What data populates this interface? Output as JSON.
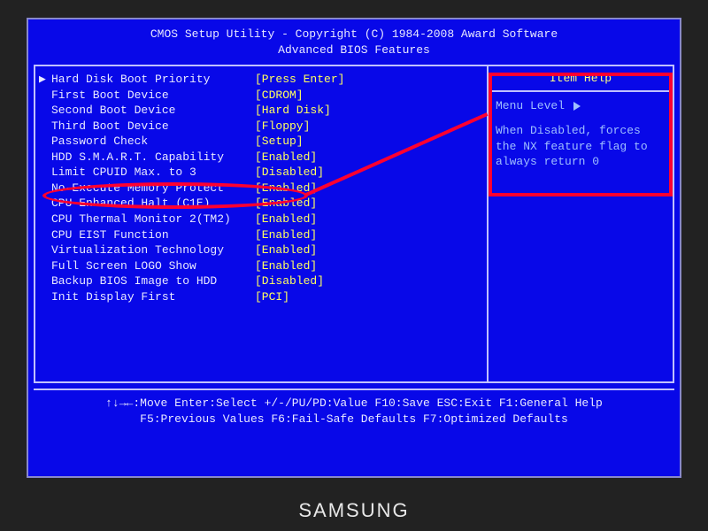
{
  "header": {
    "line1": "CMOS Setup Utility - Copyright (C) 1984-2008 Award Software",
    "line2": "Advanced BIOS Features"
  },
  "items": [
    {
      "pointer": "▶",
      "label": "Hard Disk Boot Priority",
      "value": "[Press Enter]"
    },
    {
      "pointer": "",
      "label": "First Boot Device",
      "value": "[CDROM]"
    },
    {
      "pointer": "",
      "label": "Second Boot Device",
      "value": "[Hard Disk]"
    },
    {
      "pointer": "",
      "label": "Third Boot Device",
      "value": "[Floppy]"
    },
    {
      "pointer": "",
      "label": "Password Check",
      "value": "[Setup]"
    },
    {
      "pointer": "",
      "label": "HDD S.M.A.R.T. Capability",
      "value": "[Enabled]"
    },
    {
      "pointer": "",
      "label": "Limit CPUID Max. to 3",
      "value": "[Disabled]"
    },
    {
      "pointer": "",
      "label": "No-Execute Memory Protect",
      "value": "[Enabled]"
    },
    {
      "pointer": "",
      "label": "CPU Enhanced Halt (C1E)",
      "value": "[Enabled]"
    },
    {
      "pointer": "",
      "label": "CPU Thermal Monitor 2(TM2)",
      "value": "[Enabled]"
    },
    {
      "pointer": "",
      "label": "CPU EIST Function",
      "value": "[Enabled]"
    },
    {
      "pointer": "",
      "label": "Virtualization Technology",
      "value": "[Enabled]"
    },
    {
      "pointer": "",
      "label": "Full Screen LOGO Show",
      "value": "[Enabled]"
    },
    {
      "pointer": "",
      "label": "Backup BIOS Image to HDD",
      "value": "[Disabled]"
    },
    {
      "pointer": "",
      "label": "Init Display First",
      "value": "[PCI]"
    }
  ],
  "help": {
    "title": "Item Help",
    "menu_level": "Menu Level",
    "body": "When Disabled, forces the NX feature flag to always return 0"
  },
  "footer": {
    "line1": "↑↓→←:Move  Enter:Select  +/-/PU/PD:Value  F10:Save  ESC:Exit  F1:General Help",
    "line2": "F5:Previous Values  F6:Fail-Safe Defaults  F7:Optimized Defaults"
  },
  "brand": "SAMSUNG"
}
